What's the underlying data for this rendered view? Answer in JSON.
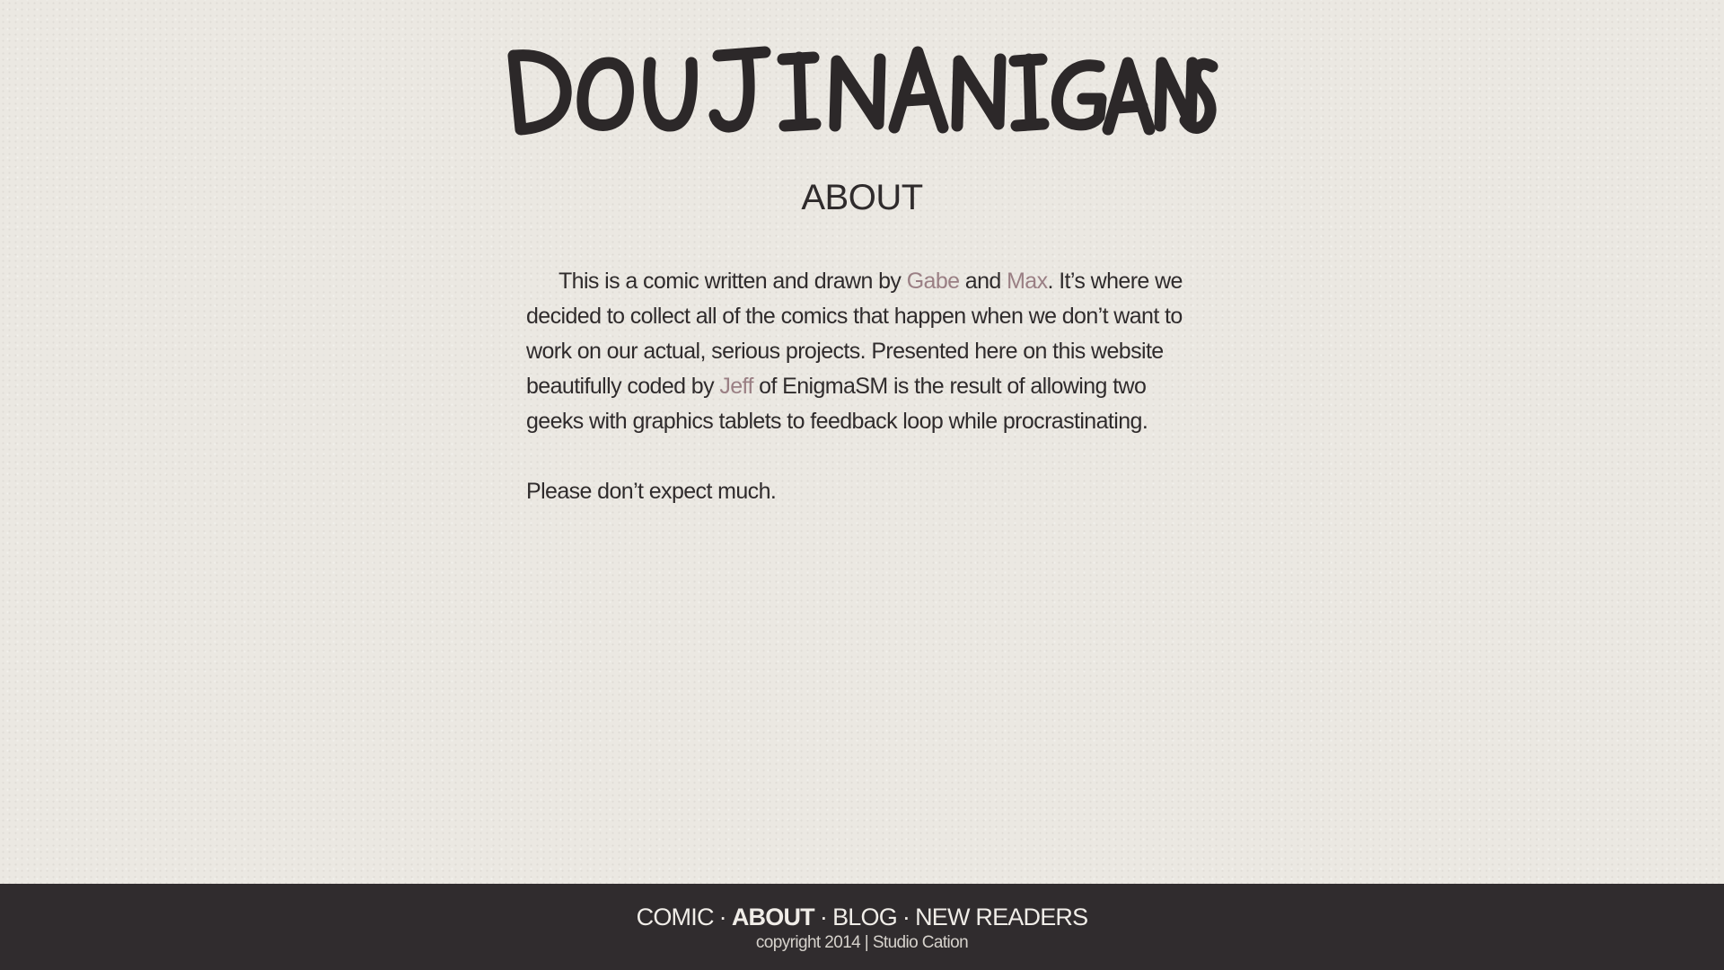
{
  "site": {
    "logo_text": "DOUJINANIGANS",
    "colors": {
      "background": "#ebe8e2",
      "text": "#2f2b2c",
      "link": "#9a7f84",
      "footer_bg": "#302c2e",
      "footer_text": "#f0ede8"
    }
  },
  "page": {
    "heading": "ABOUT",
    "intro": {
      "t1": "This is a comic written and drawn by ",
      "link_gabe": "Gabe",
      "t2": " and ",
      "link_max": "Max",
      "t3": ". It’s where we decided to collect all of the comics that happen when we don’t want to work on our actual, serious projects. Presented here on this website beautifully coded by ",
      "link_jeff": "Jeff",
      "t4": " of EnigmaSM is the result of allowing two geeks with graphics tablets to feedback loop while procrastinating."
    },
    "closing": "Please don’t expect much."
  },
  "footer": {
    "nav": {
      "comic": "COMIC",
      "about": "ABOUT",
      "blog": "BLOG",
      "new_readers": "NEW READERS",
      "separator": "·"
    },
    "copyright": "copyright 2014 | Studio Cation"
  }
}
